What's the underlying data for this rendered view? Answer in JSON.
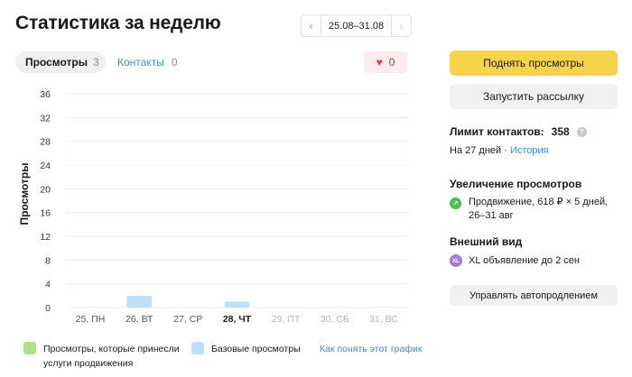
{
  "header": {
    "title": "Статистика за неделю",
    "date_range": "25.08–31.08",
    "prev_arrow": "‹",
    "next_arrow": "›"
  },
  "tabs": [
    {
      "label": "Просмотры",
      "count": "3",
      "active": true
    },
    {
      "label": "Контакты",
      "count": "0",
      "active": false
    }
  ],
  "favorites": {
    "icon": "heart-icon",
    "count": "0"
  },
  "chart_data": {
    "type": "bar",
    "ylabel": "Просмотры",
    "ylim": [
      0,
      36
    ],
    "y_ticks": [
      0,
      4,
      8,
      12,
      16,
      20,
      24,
      28,
      32,
      36
    ],
    "categories": [
      "25, ПН",
      "26, ВТ",
      "27, СР",
      "28, ЧТ",
      "29, ПТ",
      "30, СБ",
      "31, ВС"
    ],
    "category_state": [
      "past",
      "past",
      "past",
      "today",
      "future",
      "future",
      "future"
    ],
    "series": [
      {
        "name": "Базовые просмотры",
        "color": "#bfe0fb",
        "values": [
          0,
          2,
          0,
          1,
          0,
          0,
          0
        ]
      },
      {
        "name": "Просмотры, которые принесли услуги продвижения",
        "color": "#aee08d",
        "values": [
          0,
          0,
          0,
          0,
          0,
          0,
          0
        ]
      }
    ],
    "grid": true
  },
  "legend": {
    "promo_label": "Просмотры, которые принесли услуги продвижения",
    "base_label": "Базовые просмотры",
    "help_link": "Как понять этот график"
  },
  "sidebar": {
    "raise_button": "Поднять просмотры",
    "mailing_button": "Запустить рассылку",
    "limit_title": "Лимит контактов:",
    "limit_value": "358",
    "limit_days": "На 27 дней · ",
    "history_link": "История",
    "boost_title": "Увеличение просмотров",
    "boost_text": "Продвижение, 618 ₽ × 5 дней, 26–31 авг",
    "look_title": "Внешний вид",
    "look_badge": "XL",
    "look_text": "XL объявление до 2 сен",
    "autorenew_button": "Управлять автопродлением"
  },
  "colors": {
    "accent_yellow": "#f7d34a",
    "link_blue": "#3d8fd6",
    "bar_base": "#bfe0fb",
    "bar_promo": "#aee08d"
  }
}
